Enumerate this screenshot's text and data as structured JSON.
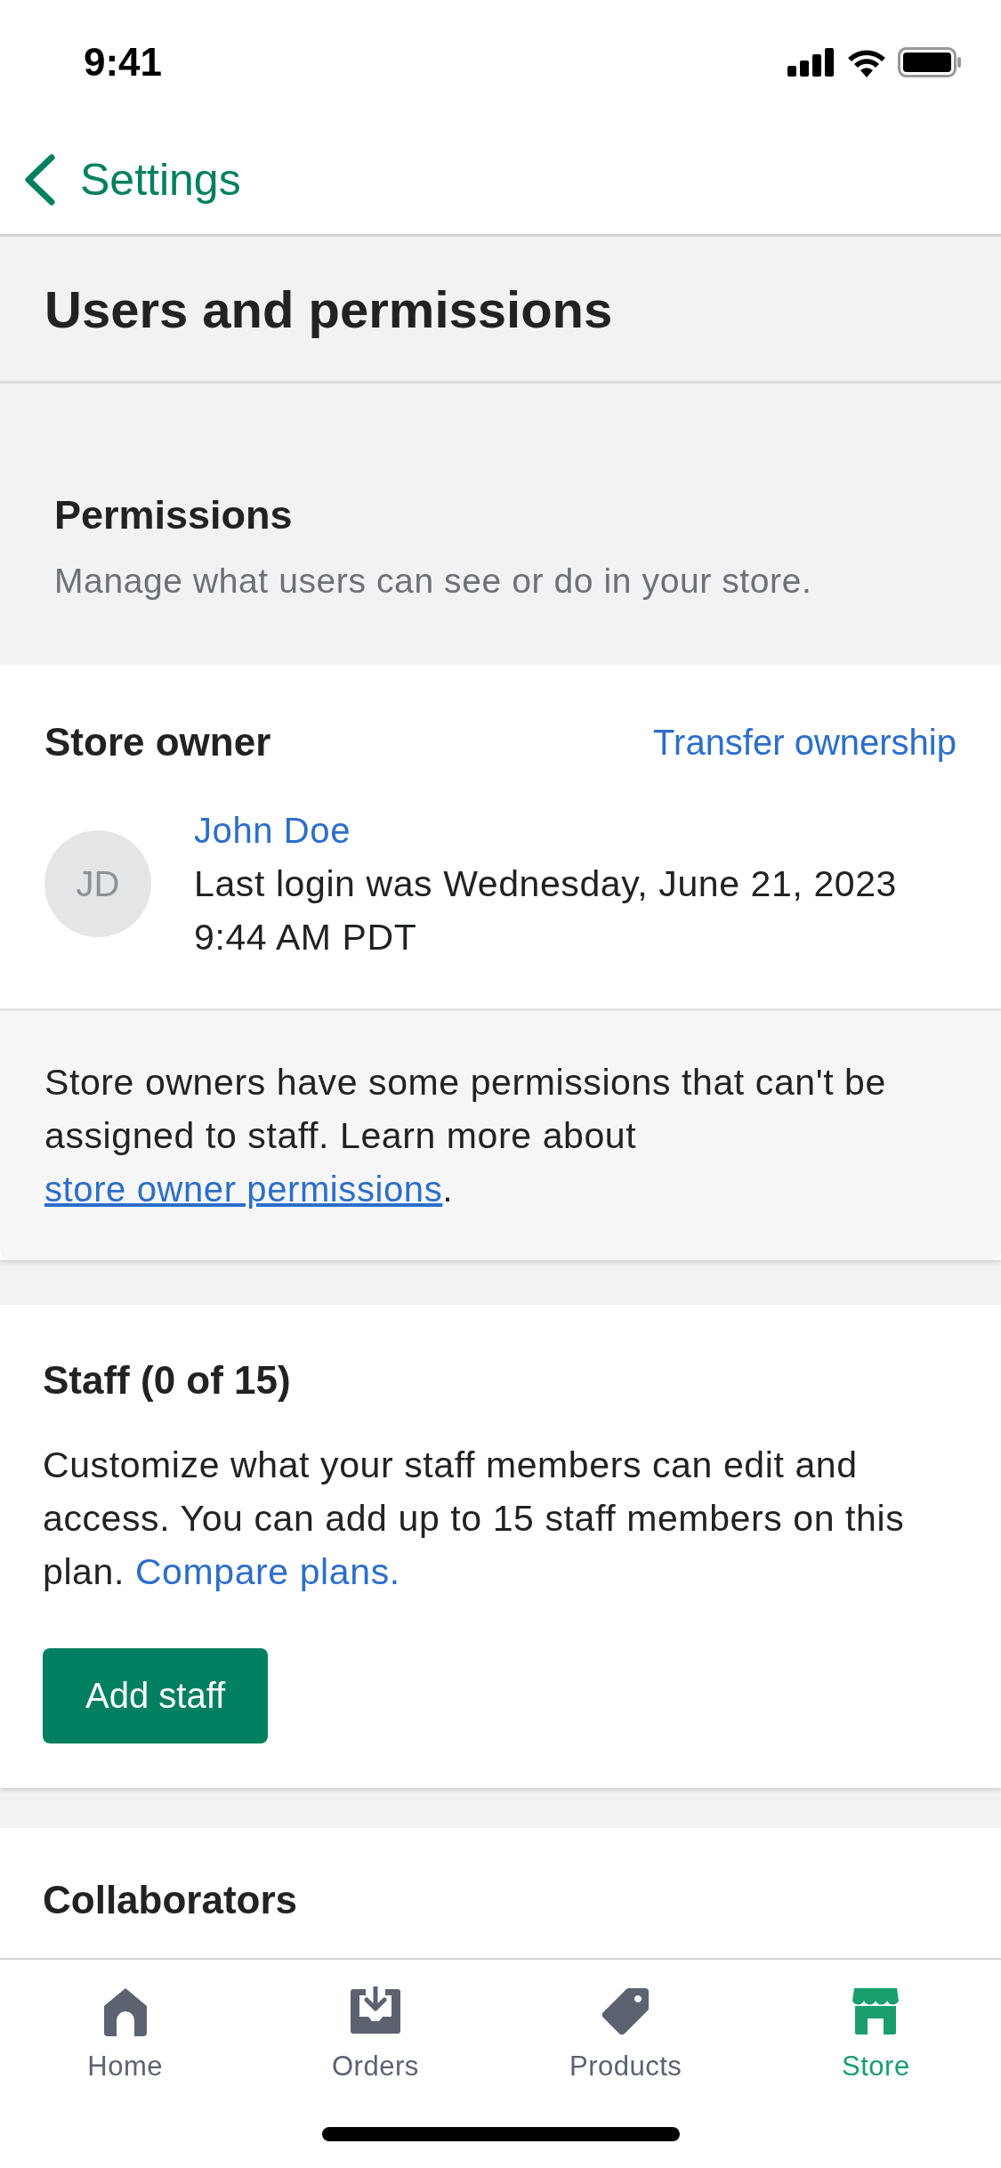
{
  "status_bar": {
    "time": "9:41"
  },
  "nav": {
    "back_label": "Settings"
  },
  "page_title": "Users and permissions",
  "permissions": {
    "title": "Permissions",
    "description": "Manage what users can see or do in your store."
  },
  "store_owner": {
    "title": "Store owner",
    "action": "Transfer ownership",
    "initials": "JD",
    "name": "John Doe",
    "last_login": "Last login was Wednesday, June 21, 2023 9:44 AM PDT",
    "notice": "Store owners have some permissions that can't be assigned to staff. Learn more about",
    "notice_link": "store owner permissions",
    "notice_end": "."
  },
  "staff": {
    "title": "Staff (0 of 15)",
    "description": "Customize what your staff members can edit and access. You can add up to 15 staff members on this plan.",
    "link": "Compare plans.",
    "button": "Add staff"
  },
  "collaborators": {
    "title": "Collaborators"
  },
  "tabs": [
    {
      "label": "Home",
      "selected": false
    },
    {
      "label": "Orders",
      "selected": false
    },
    {
      "label": "Products",
      "selected": false
    },
    {
      "label": "Store",
      "selected": true
    }
  ]
}
